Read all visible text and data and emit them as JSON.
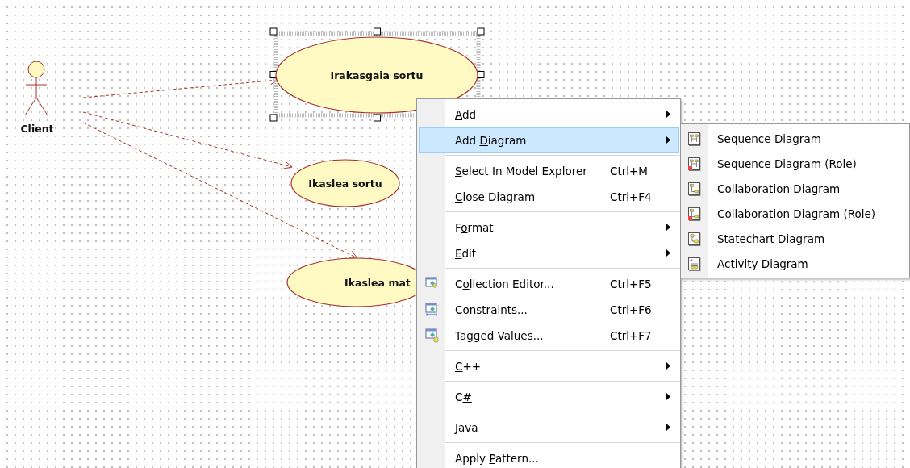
{
  "diagram": {
    "actor": {
      "label": "Client"
    },
    "use_cases": [
      {
        "label": "Irakasgaia sortu",
        "selected": true
      },
      {
        "label": "Ikaslea sortu",
        "selected": false
      },
      {
        "label": "Ikaslea mat",
        "selected": false
      }
    ]
  },
  "context_menu": {
    "items": [
      {
        "kind": "item",
        "access_key": "A",
        "text_after": "dd",
        "has_submenu": true,
        "selected": false
      },
      {
        "kind": "item",
        "text_before": "Add ",
        "access_key": "D",
        "text_after": "iagram",
        "has_submenu": true,
        "selected": true
      },
      {
        "kind": "separator"
      },
      {
        "kind": "item",
        "access_key": "S",
        "text_after": "elect In Model Explorer",
        "shortcut": "Ctrl+M",
        "selected": false
      },
      {
        "kind": "item",
        "access_key": "C",
        "text_after": "lose Diagram",
        "shortcut": "Ctrl+F4",
        "selected": false
      },
      {
        "kind": "separator"
      },
      {
        "kind": "item",
        "text_before": "F",
        "access_key": "o",
        "text_after": "rmat",
        "has_submenu": true,
        "selected": false
      },
      {
        "kind": "item",
        "access_key": "E",
        "text_after": "dit",
        "has_submenu": true,
        "selected": false
      },
      {
        "kind": "separator"
      },
      {
        "kind": "item",
        "text_before": "C",
        "access_key": "o",
        "text_after": "llection Editor...",
        "shortcut": "Ctrl+F5",
        "icon": true,
        "selected": false
      },
      {
        "kind": "item",
        "access_key": "C",
        "text_after": "onstraints...",
        "shortcut": "Ctrl+F6",
        "icon": true,
        "selected": false
      },
      {
        "kind": "item",
        "access_key": "T",
        "text_after": "agged Values...",
        "shortcut": "Ctrl+F7",
        "icon": true,
        "selected": false
      },
      {
        "kind": "separator"
      },
      {
        "kind": "item",
        "access_key": "C",
        "text_after": "++",
        "has_submenu": true,
        "selected": false
      },
      {
        "kind": "separator"
      },
      {
        "kind": "item",
        "text_before": "C",
        "access_key": "#",
        "has_submenu": true,
        "selected": false
      },
      {
        "kind": "separator"
      },
      {
        "kind": "item",
        "access_key": "J",
        "text_after": "ava",
        "has_submenu": true,
        "selected": false
      },
      {
        "kind": "separator"
      },
      {
        "kind": "item",
        "text_before": "Apply ",
        "access_key": "P",
        "text_after": "attern...",
        "selected": false
      }
    ]
  },
  "submenu": {
    "items": [
      {
        "label": "Sequence Diagram",
        "role": false
      },
      {
        "label": "Sequence Diagram (Role)",
        "role": true
      },
      {
        "label": "Collaboration Diagram",
        "role": false
      },
      {
        "label": "Collaboration Diagram (Role)",
        "role": true
      },
      {
        "label": "Statechart Diagram",
        "role": false
      },
      {
        "label": "Activity Diagram",
        "role": false
      }
    ]
  }
}
